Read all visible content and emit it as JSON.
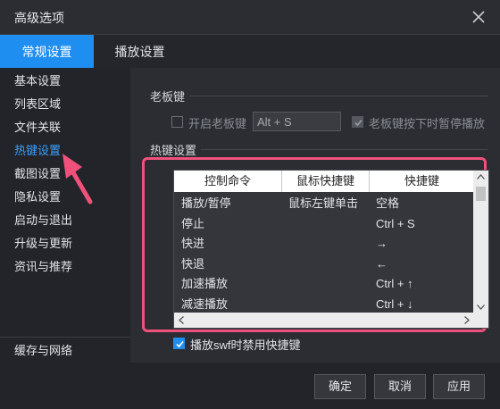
{
  "window": {
    "title": "高级选项"
  },
  "tabs": [
    {
      "label": "常规设置",
      "active": true
    },
    {
      "label": "播放设置",
      "active": false
    }
  ],
  "sidebar": {
    "items": [
      {
        "label": "基本设置"
      },
      {
        "label": "列表区域"
      },
      {
        "label": "文件关联"
      },
      {
        "label": "热键设置",
        "active": true
      },
      {
        "label": "截图设置"
      },
      {
        "label": "隐私设置"
      },
      {
        "label": "启动与退出"
      },
      {
        "label": "升级与更新"
      },
      {
        "label": "资讯与推荐"
      }
    ],
    "bottom_item": "缓存与网络"
  },
  "boss_key": {
    "section_title": "老板键",
    "enable_label": "开启老板键",
    "enable_checked": false,
    "key_value": "Alt + S",
    "pause_label": "老板键按下时暂停播放",
    "pause_checked": true
  },
  "hotkeys": {
    "section_title": "热键设置",
    "columns": [
      "控制命令",
      "鼠标快捷键",
      "快捷键"
    ],
    "rows": [
      {
        "command": "播放/暂停",
        "mouse": "鼠标左键单击",
        "key": "空格"
      },
      {
        "command": "停止",
        "mouse": "",
        "key": "Ctrl + S"
      },
      {
        "command": "快进",
        "mouse": "",
        "key": "→"
      },
      {
        "command": "快退",
        "mouse": "",
        "key": "←"
      },
      {
        "command": "加速播放",
        "mouse": "",
        "key": "Ctrl + ↑"
      },
      {
        "command": "减速播放",
        "mouse": "",
        "key": "Ctrl + ↓"
      }
    ],
    "swf_label": "播放swf时禁用快捷键",
    "swf_checked": true
  },
  "footer": {
    "ok": "确定",
    "cancel": "取消",
    "apply": "应用"
  },
  "colors": {
    "accent": "#1f8ef1",
    "highlight": "#f0517a",
    "active_text": "#3aa0ff"
  }
}
